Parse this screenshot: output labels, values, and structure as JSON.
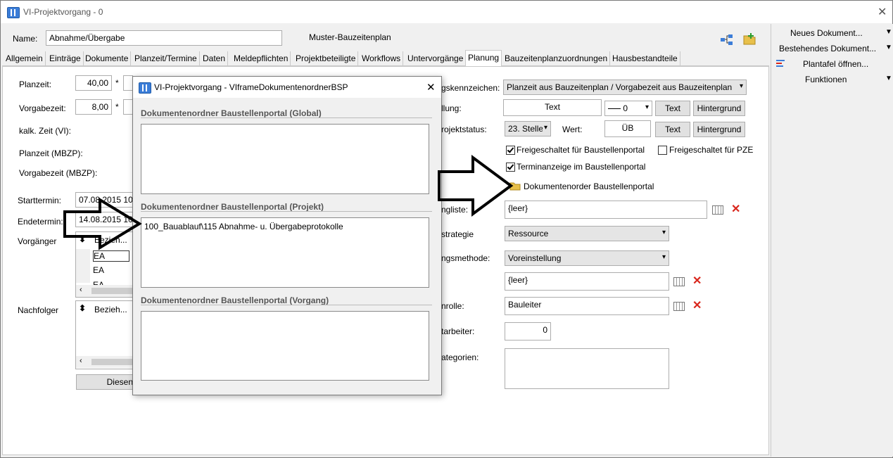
{
  "window": {
    "title": "VI-Projektvorgang - 0",
    "close": "✕"
  },
  "header": {
    "name_label": "Name:",
    "name_value": "Abnahme/Übergabe",
    "template_label": "Muster-Bauzeitenplan"
  },
  "tabs": [
    "Allgemein",
    "Einträge",
    "Dokumente",
    "Planzeit/Termine",
    "Daten",
    "Meldepflichten",
    "Projektbeteiligte",
    "Workflows",
    "Untervorgänge",
    "Planung",
    "Bauzeitenplanzuordnungen",
    "Hausbestandteile"
  ],
  "active_tab": "Planung",
  "left": {
    "planzeit_label": "Planzeit:",
    "planzeit_value": "40,00",
    "star": "*",
    "vorgabezeit_label": "Vorgabezeit:",
    "vorgabezeit_value": "8,00",
    "kalk_label": "kalk. Zeit (VI):",
    "planzeit_mbzp_label": "Planzeit (MBZP):",
    "vorgabezeit_mbzp_label": "Vorgabezeit (MBZP):",
    "starttermin_label": "Starttermin:",
    "starttermin_value": "07.08.2015 10:0",
    "endetermin_label": "Endetermin:",
    "endetermin_value": "14.08.2015 10:0",
    "vorgaenger_label": "Vorgänger",
    "vorgaenger_col": "Bezieh...",
    "vorgaenger_rows": [
      "EA",
      "EA",
      "EA"
    ],
    "nachfolger_label": "Nachfolger",
    "nachfolger_col": "Bezieh...",
    "diesen_button": "Diesen"
  },
  "right": {
    "kennzeichen_label": "gskennzeichen:",
    "kennzeichen_value": "Planzeit aus Bauzeitenplan / Vorgabezeit aus Bauzeitenplan",
    "darstellung_label": "llung:",
    "darstellung_text": "Text",
    "line_value": "0",
    "text_button": "Text",
    "hintergrund_button": "Hintergrund",
    "projektstatus_label": "rojektstatus:",
    "projektstatus_value": "23. Stelle",
    "wert_label": "Wert:",
    "wert_value": "ÜB",
    "text_button2": "Text",
    "hintergrund_button2": "Hintergrund",
    "cb_baustellenportal": "Freigeschaltet für Baustellenportal",
    "cb_pze": "Freigeschaltet für PZE",
    "cb_terminanzeige": "Terminanzeige im Baustellenportal",
    "dokumentenorder": "Dokumentenorder Baustellenportal",
    "ngliste_label": "ngliste:",
    "ngliste_value": "{leer}",
    "strategie_label": "strategie",
    "strategie_value": "Ressource",
    "methode_label": "ngsmethode:",
    "methode_value": "Voreinstellung",
    "leer2_value": "{leer}",
    "rolle_label": "nrolle:",
    "rolle_value": "Bauleiter",
    "mitarbeiter_label": "tarbeiter:",
    "mitarbeiter_value": "0",
    "kategorien_label": "ategorien:"
  },
  "sidebar": {
    "items": [
      "Neues Dokument...",
      "Bestehendes Dokument...",
      "Plantafel öffnen...",
      "Funktionen"
    ]
  },
  "dialog": {
    "title": "VI-Projektvorgang - VIframeDokumentenordnerBSP",
    "close": "✕",
    "sections": [
      {
        "title": "Dokumentenordner Baustellenportal (Global)",
        "content": ""
      },
      {
        "title": "Dokumentenordner Baustellenportal (Projekt)",
        "content": "100_Bauablauf\\115 Abnahme- u. Übergabeprotokolle"
      },
      {
        "title": "Dokumentenordner Baustellenportal (Vorgang)",
        "content": ""
      }
    ]
  },
  "colors": {
    "accent": "#0078d7",
    "delete": "#d9261c",
    "tab_active_bg": "#ffffff"
  }
}
